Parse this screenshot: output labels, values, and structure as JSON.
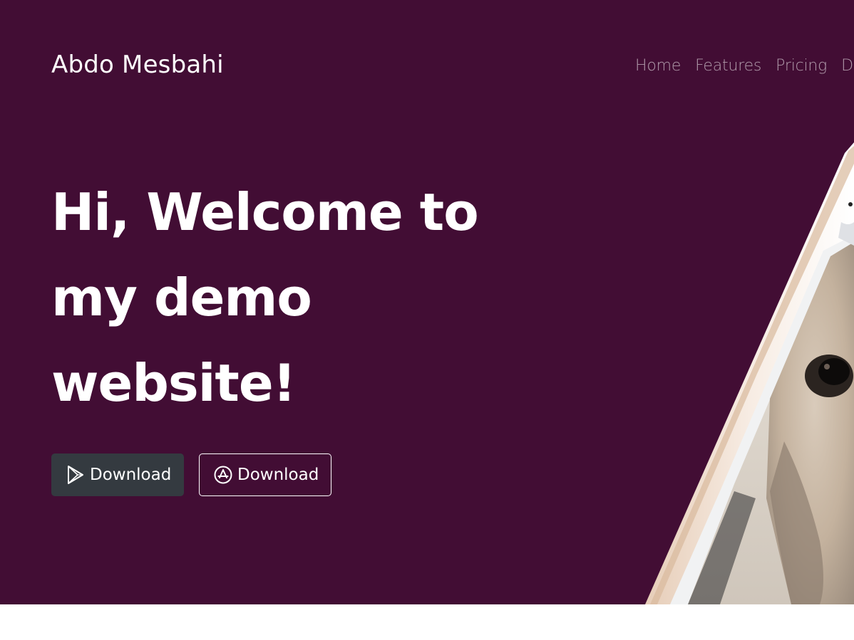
{
  "header": {
    "brand": "Abdo Mesbahi",
    "nav": [
      {
        "label": "Home"
      },
      {
        "label": "Features"
      },
      {
        "label": "Pricing"
      },
      {
        "label": "D"
      }
    ]
  },
  "hero": {
    "headline_lines": [
      "Hi, Welcome to",
      "my demo",
      "website!"
    ],
    "buttons": [
      {
        "label": "Download",
        "icon": "google-play-icon"
      },
      {
        "label": "Download",
        "icon": "app-store-icon"
      }
    ]
  },
  "colors": {
    "hero_background": "#420d34",
    "dark_button": "#343a40",
    "text": "#ffffff"
  }
}
